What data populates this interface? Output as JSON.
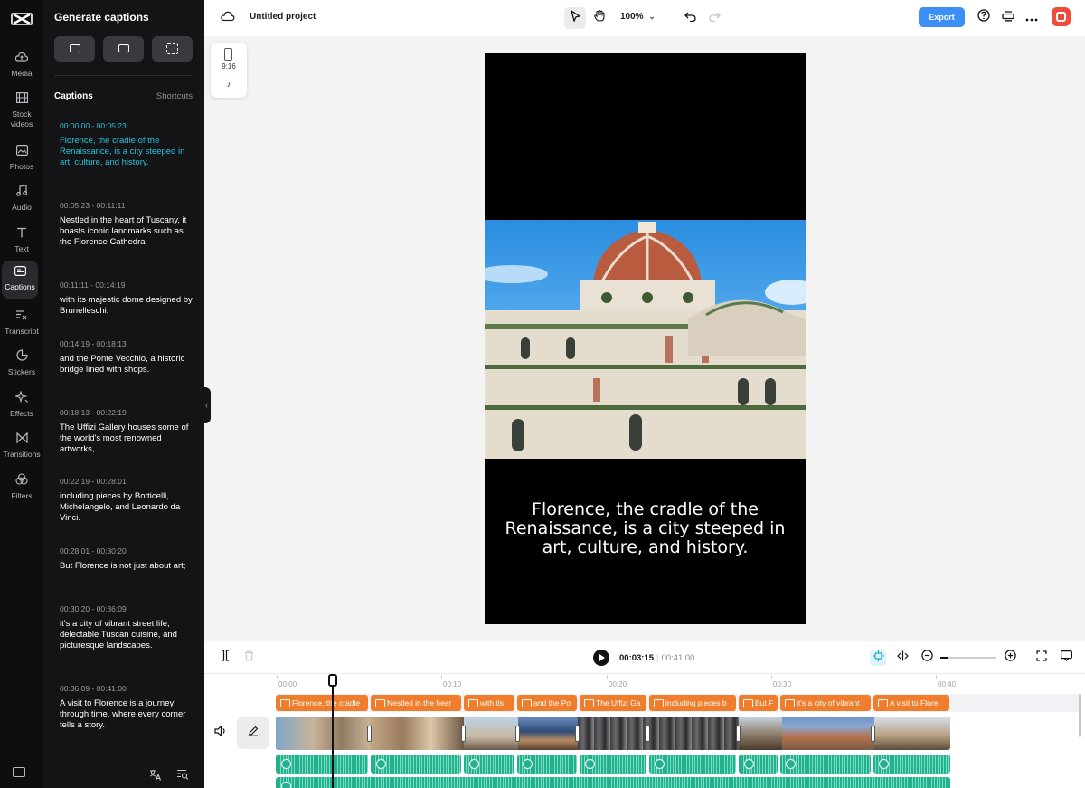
{
  "rail": {
    "items": [
      {
        "label": "Media",
        "icon": "media-icon"
      },
      {
        "label": "Stock videos",
        "icon": "film-icon"
      },
      {
        "label": "Photos",
        "icon": "image-icon"
      },
      {
        "label": "Audio",
        "icon": "music-icon"
      },
      {
        "label": "Text",
        "icon": "text-icon"
      },
      {
        "label": "Captions",
        "icon": "captions-icon"
      },
      {
        "label": "Transcript",
        "icon": "transcript-icon"
      },
      {
        "label": "Stickers",
        "icon": "sticker-icon"
      },
      {
        "label": "Effects",
        "icon": "sparkle-icon"
      },
      {
        "label": "Transitions",
        "icon": "transition-icon"
      },
      {
        "label": "Filters",
        "icon": "filter-icon"
      }
    ],
    "active": "Captions"
  },
  "panel": {
    "title": "Generate captions",
    "tab_captions": "Captions",
    "tab_shortcuts": "Shortcuts",
    "captions": [
      {
        "time": "00:00:00 - 00:05:23",
        "text": "Florence, the cradle of the Renaissance, is a city steeped in art, culture, and history.",
        "active": true
      },
      {
        "time": "00:05:23 - 00:11:11",
        "text": "Nestled in the heart of Tuscany, it boasts iconic landmarks such as the Florence Cathedral"
      },
      {
        "time": "00:11:11 - 00:14:19",
        "text": "with its majestic dome designed by Brunelleschi,"
      },
      {
        "time": "00:14:19 - 00:18:13",
        "text": "and the Ponte Vecchio, a historic bridge lined with shops."
      },
      {
        "time": "00:18:13 - 00:22:19",
        "text": "The Uffizi Gallery houses some of the world's most renowned artworks,"
      },
      {
        "time": "00:22:19 - 00:28:01",
        "text": "including pieces by Botticelli, Michelangelo, and Leonardo da Vinci."
      },
      {
        "time": "00:28:01 - 00:30:20",
        "text": "But Florence is not just about art;"
      },
      {
        "time": "00:30:20 - 00:36:09",
        "text": "it's a city of vibrant street life, delectable Tuscan cuisine, and picturesque landscapes."
      },
      {
        "time": "00:36:09 - 00:41:00",
        "text": "A visit to Florence is a journey through time, where every corner tells a story."
      }
    ]
  },
  "topbar": {
    "project_title": "Untitled project",
    "zoom": "100%",
    "export_label": "Export"
  },
  "ratio": {
    "label": "9:16",
    "platform_icon": "tiktok-icon"
  },
  "preview": {
    "subtitle": "Florence, the cradle of the Renaissance, is a city steeped in art, culture, and history."
  },
  "timeline": {
    "current_time": "00:03:15",
    "separator": "|",
    "total_time": "00:41:00",
    "ruler": [
      "00:00",
      "00:10",
      "00:20",
      "00:30",
      "00:40"
    ],
    "caption_clips": [
      "Florence, the cradle",
      "Nestled in the hear",
      "with its",
      "and the Po",
      "The Uffizi Ga",
      "including pieces b",
      "But F",
      "it's a city of vibrant",
      "A visit to Flore"
    ]
  },
  "colors": {
    "accent": "#27c3de",
    "export": "#3b8ff5",
    "caption_clip": "#ef7d2b",
    "audio_clip": "#22b08e",
    "brand": "#ef4c3c"
  }
}
